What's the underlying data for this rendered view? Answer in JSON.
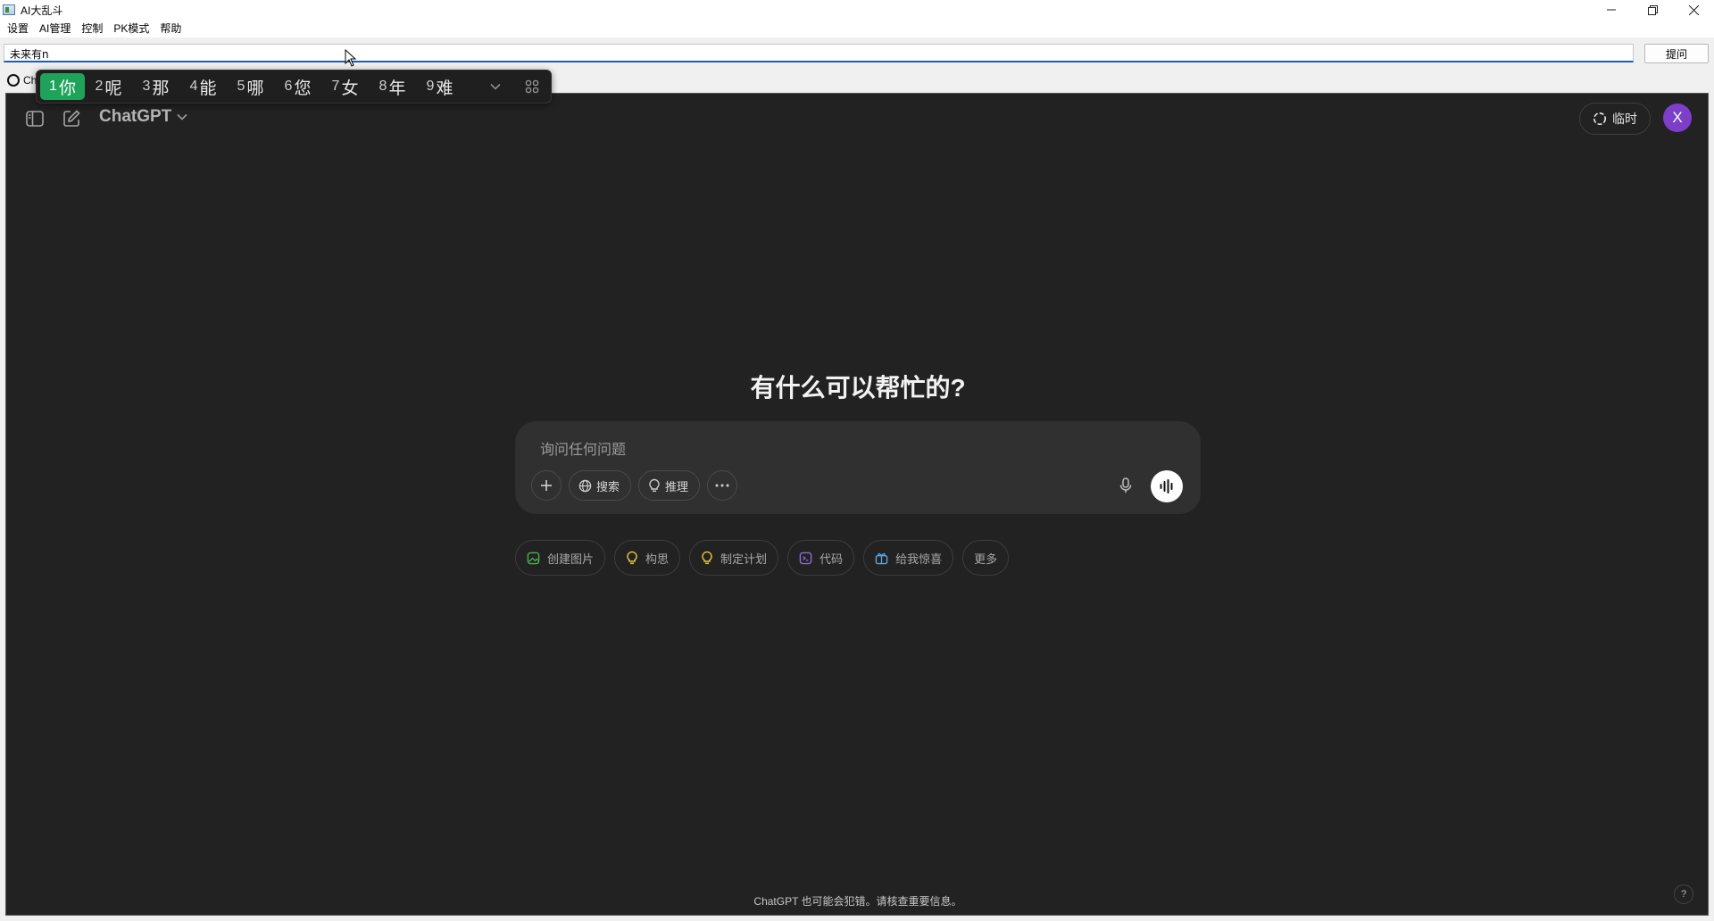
{
  "window": {
    "title": "AI大乱斗",
    "controls": {
      "minimize_icon": "minimize-icon",
      "maximize_icon": "restore-icon",
      "close_icon": "close-icon"
    }
  },
  "menu": [
    "设置",
    "AI管理",
    "控制",
    "PK模式",
    "帮助"
  ],
  "question_bar": {
    "input_value": "未来有n",
    "submit_label": "提问"
  },
  "tabs": [
    {
      "label": "Ch",
      "icon": "openai-logo-icon"
    }
  ],
  "ime": {
    "candidates": [
      {
        "num": "1",
        "text": "你",
        "selected": true
      },
      {
        "num": "2",
        "text": "呢"
      },
      {
        "num": "3",
        "text": "那"
      },
      {
        "num": "4",
        "text": "能"
      },
      {
        "num": "5",
        "text": "哪"
      },
      {
        "num": "6",
        "text": "您"
      },
      {
        "num": "7",
        "text": "女"
      },
      {
        "num": "8",
        "text": "年"
      },
      {
        "num": "9",
        "text": "难"
      }
    ],
    "selected_color": "#1fa35b"
  },
  "chatgpt": {
    "model_label": "ChatGPT",
    "temporary_label": "临时",
    "avatar_letter": "X",
    "avatar_color": "#7d3ec9",
    "heading": "有什么可以帮忙的?",
    "composer": {
      "placeholder": "询问任何问题",
      "tools": [
        {
          "label": "搜索",
          "icon": "globe-icon"
        },
        {
          "label": "推理",
          "icon": "lightbulb-icon"
        }
      ]
    },
    "suggestions": [
      {
        "label": "创建图片",
        "icon": "image-icon",
        "color": "#4caf50"
      },
      {
        "label": "构思",
        "icon": "lightbulb-icon",
        "color": "#e2c541"
      },
      {
        "label": "制定计划",
        "icon": "lightbulb-icon",
        "color": "#e2c541"
      },
      {
        "label": "代码",
        "icon": "code-icon",
        "color": "#8a6fd6"
      },
      {
        "label": "给我惊喜",
        "icon": "gift-icon",
        "color": "#5aa7e0"
      },
      {
        "label": "更多",
        "icon": "",
        "color": ""
      }
    ],
    "footer": "ChatGPT 也可能会犯错。请核查重要信息。",
    "help": "?"
  }
}
